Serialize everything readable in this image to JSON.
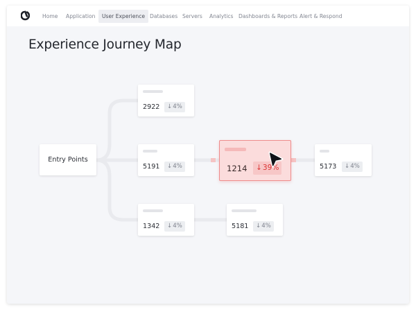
{
  "nav": {
    "logo_icon": "app-logo-icon",
    "items": [
      {
        "label": "Home",
        "active": false
      },
      {
        "label": "Application",
        "active": false
      },
      {
        "label": "User Experience",
        "active": true
      },
      {
        "label": "Databases",
        "active": false
      },
      {
        "label": "Servers",
        "active": false
      },
      {
        "label": "Analytics",
        "active": false
      },
      {
        "label": "Dashboards & Reports",
        "active": false
      },
      {
        "label": "Alert & Respond",
        "active": false
      }
    ]
  },
  "page": {
    "title": "Experience Journey Map"
  },
  "journey": {
    "entry_label": "Entry Points",
    "delta_icon": "arrow-down-icon",
    "nodes": {
      "top": {
        "value": "2922",
        "delta": "4%"
      },
      "middle": {
        "value": "5191",
        "delta": "4%"
      },
      "bottom": {
        "value": "1342",
        "delta": "4%"
      },
      "alert": {
        "value": "1214",
        "delta": "39%"
      },
      "right": {
        "value": "5173",
        "delta": "4%"
      },
      "bottom_right": {
        "value": "5181",
        "delta": "4%"
      }
    }
  },
  "colors": {
    "alert_fill": "#fbdcdc",
    "alert_border": "#ee8c8c",
    "alert_text": "#dc3535",
    "connector": "#e9eaee",
    "alert_connector": "#f5c4c4"
  },
  "cursor_icon": "cursor-pointer-icon"
}
